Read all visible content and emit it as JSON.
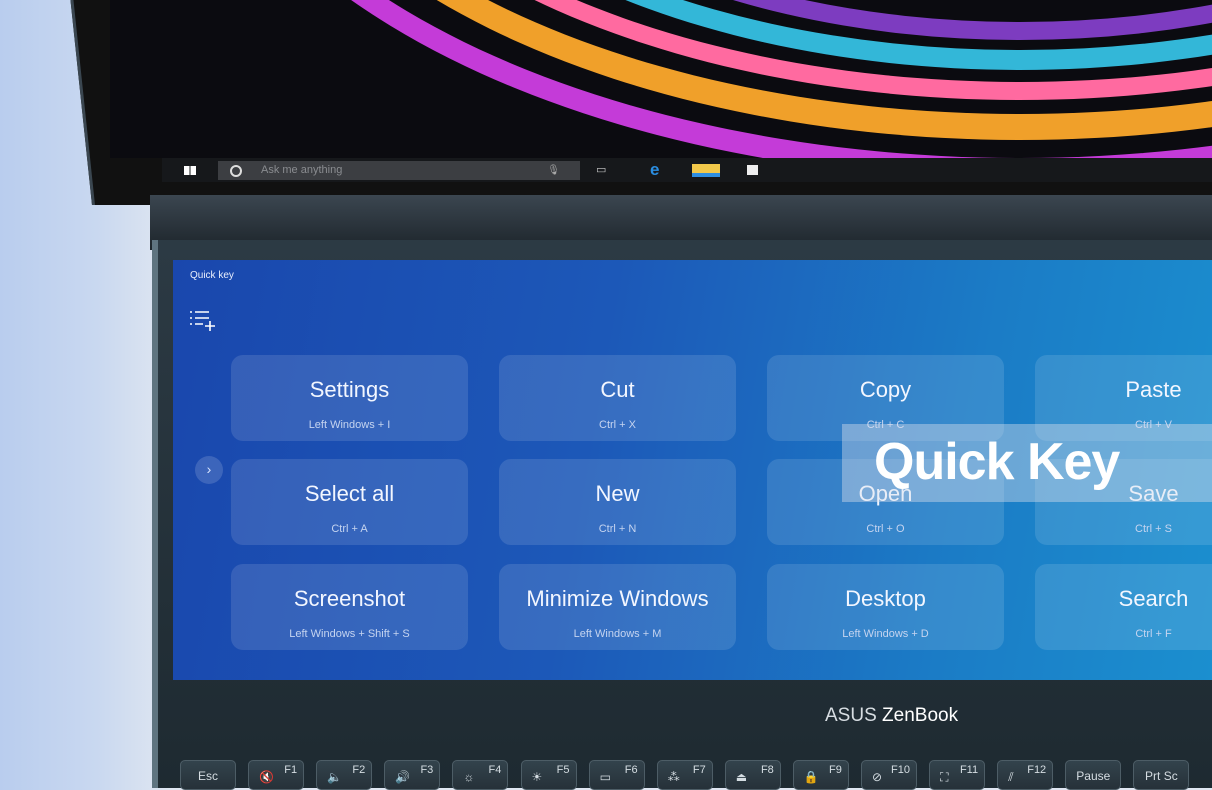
{
  "taskbar": {
    "search_placeholder": "Ask me anything",
    "icons": [
      "windows-start-icon",
      "cortana-icon",
      "microphone-icon",
      "task-view-icon",
      "edge-icon",
      "file-explorer-icon",
      "store-icon"
    ]
  },
  "screenpad": {
    "title": "Quick key",
    "add_icon": "list-add-icon",
    "pager_icon": "chevron-right-icon",
    "tiles": [
      {
        "label": "Settings",
        "shortcut": "Left Windows + I"
      },
      {
        "label": "Cut",
        "shortcut": "Ctrl + X"
      },
      {
        "label": "Copy",
        "shortcut": "Ctrl + C"
      },
      {
        "label": "Paste",
        "shortcut": "Ctrl + V"
      },
      {
        "label": "Select all",
        "shortcut": "Ctrl + A"
      },
      {
        "label": "New",
        "shortcut": "Ctrl + N"
      },
      {
        "label": "Open",
        "shortcut": "Ctrl + O"
      },
      {
        "label": "Save",
        "shortcut": "Ctrl + S"
      },
      {
        "label": "Screenshot",
        "shortcut": "Left Windows + Shift + S"
      },
      {
        "label": "Minimize Windows",
        "shortcut": "Left Windows + M"
      },
      {
        "label": "Desktop",
        "shortcut": "Left Windows + D"
      },
      {
        "label": "Search",
        "shortcut": "Ctrl + F"
      }
    ]
  },
  "overlay": {
    "caption": "Quick Key"
  },
  "brand": {
    "maker": "ASUS",
    "model": "ZenBook"
  },
  "keyboard": [
    {
      "label": "Esc"
    },
    {
      "fn": "F1",
      "glyph": "🔇"
    },
    {
      "fn": "F2",
      "glyph": "🔈"
    },
    {
      "fn": "F3",
      "glyph": "🔊"
    },
    {
      "fn": "F4",
      "glyph": "☼"
    },
    {
      "fn": "F5",
      "glyph": "☀"
    },
    {
      "fn": "F6",
      "glyph": "▭"
    },
    {
      "fn": "F7",
      "glyph": "⁂"
    },
    {
      "fn": "F8",
      "glyph": "⏏"
    },
    {
      "fn": "F9",
      "glyph": "🔒"
    },
    {
      "fn": "F10",
      "glyph": "⊘"
    },
    {
      "fn": "F11",
      "glyph": "⛶"
    },
    {
      "fn": "F12",
      "glyph": "⫽"
    },
    {
      "label": "Pause"
    },
    {
      "label": "Prt Sc"
    }
  ]
}
